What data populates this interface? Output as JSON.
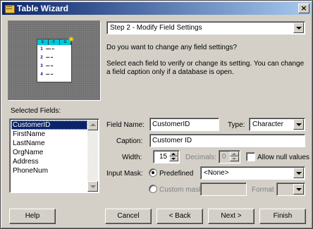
{
  "window": {
    "title": "Table Wizard",
    "close_glyph": "×"
  },
  "preview": {
    "header_cells": [
      "E",
      "F",
      "G"
    ],
    "rows": [
      {
        "num": "1",
        "dots": "▪▪▪▪ ▪▪"
      },
      {
        "num": "2",
        "dots": "▪▪▪ ▪▪"
      },
      {
        "num": "3",
        "dots": "▪▪▪ ▪▪"
      },
      {
        "num": "4",
        "dots": "▪▪▪ ▪▪"
      }
    ]
  },
  "step": {
    "selected": "Step 2 - Modify Field Settings"
  },
  "question": "Do you want to change any field settings?",
  "description": "Select each field to verify or change its setting. You can change a field caption only if a database is open.",
  "selected_fields": {
    "label": "Selected Fields:",
    "items": [
      "CustomerID",
      "FirstName",
      "LastName",
      "OrgName",
      "Address",
      "PhoneNum"
    ],
    "selected_index": 0
  },
  "form": {
    "field_name_label": "Field Name:",
    "field_name_value": "CustomerID",
    "type_label": "Type:",
    "type_value": "Character",
    "caption_label": "Caption:",
    "caption_value": "Customer ID",
    "width_label": "Width:",
    "width_value": "15",
    "decimals_label": "Decimals:",
    "decimals_value": "0",
    "allow_null_label": "Allow null values",
    "input_mask_label": "Input Mask:",
    "predefined_label": "Predefined",
    "predefined_value": "<None>",
    "custom_mask_label": "Custom mask",
    "format_label": "Format"
  },
  "buttons": {
    "help": "Help",
    "cancel": "Cancel",
    "back": "< Back",
    "next": "Next >",
    "finish": "Finish"
  }
}
